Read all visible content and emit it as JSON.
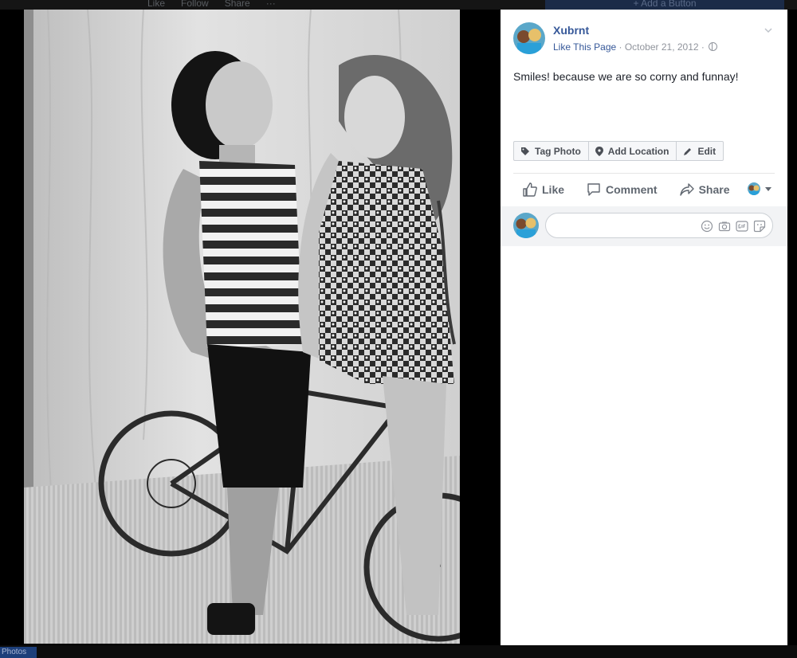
{
  "background": {
    "actions": [
      "Like",
      "Follow",
      "Share",
      "···"
    ],
    "add_button": "+ Add a Button",
    "bottom_tag": "Photos"
  },
  "post": {
    "page_name": "Xubrnt",
    "like_link": "Like This Page",
    "separator": " · ",
    "date": "October 21, 2012",
    "audience_icon": "globe-icon",
    "caption": "Smiles! because we are so corny and funnay!"
  },
  "tag_bar": {
    "tag_photo": "Tag Photo",
    "add_location": "Add Location",
    "edit": "Edit"
  },
  "actions": {
    "like": "Like",
    "comment": "Comment",
    "share": "Share"
  },
  "comment_box": {
    "placeholder": "",
    "icons": [
      "emoji-icon",
      "camera-icon",
      "gif-icon",
      "sticker-icon"
    ]
  },
  "colors": {
    "link": "#365899",
    "muted": "#90949c",
    "action": "#606770"
  }
}
